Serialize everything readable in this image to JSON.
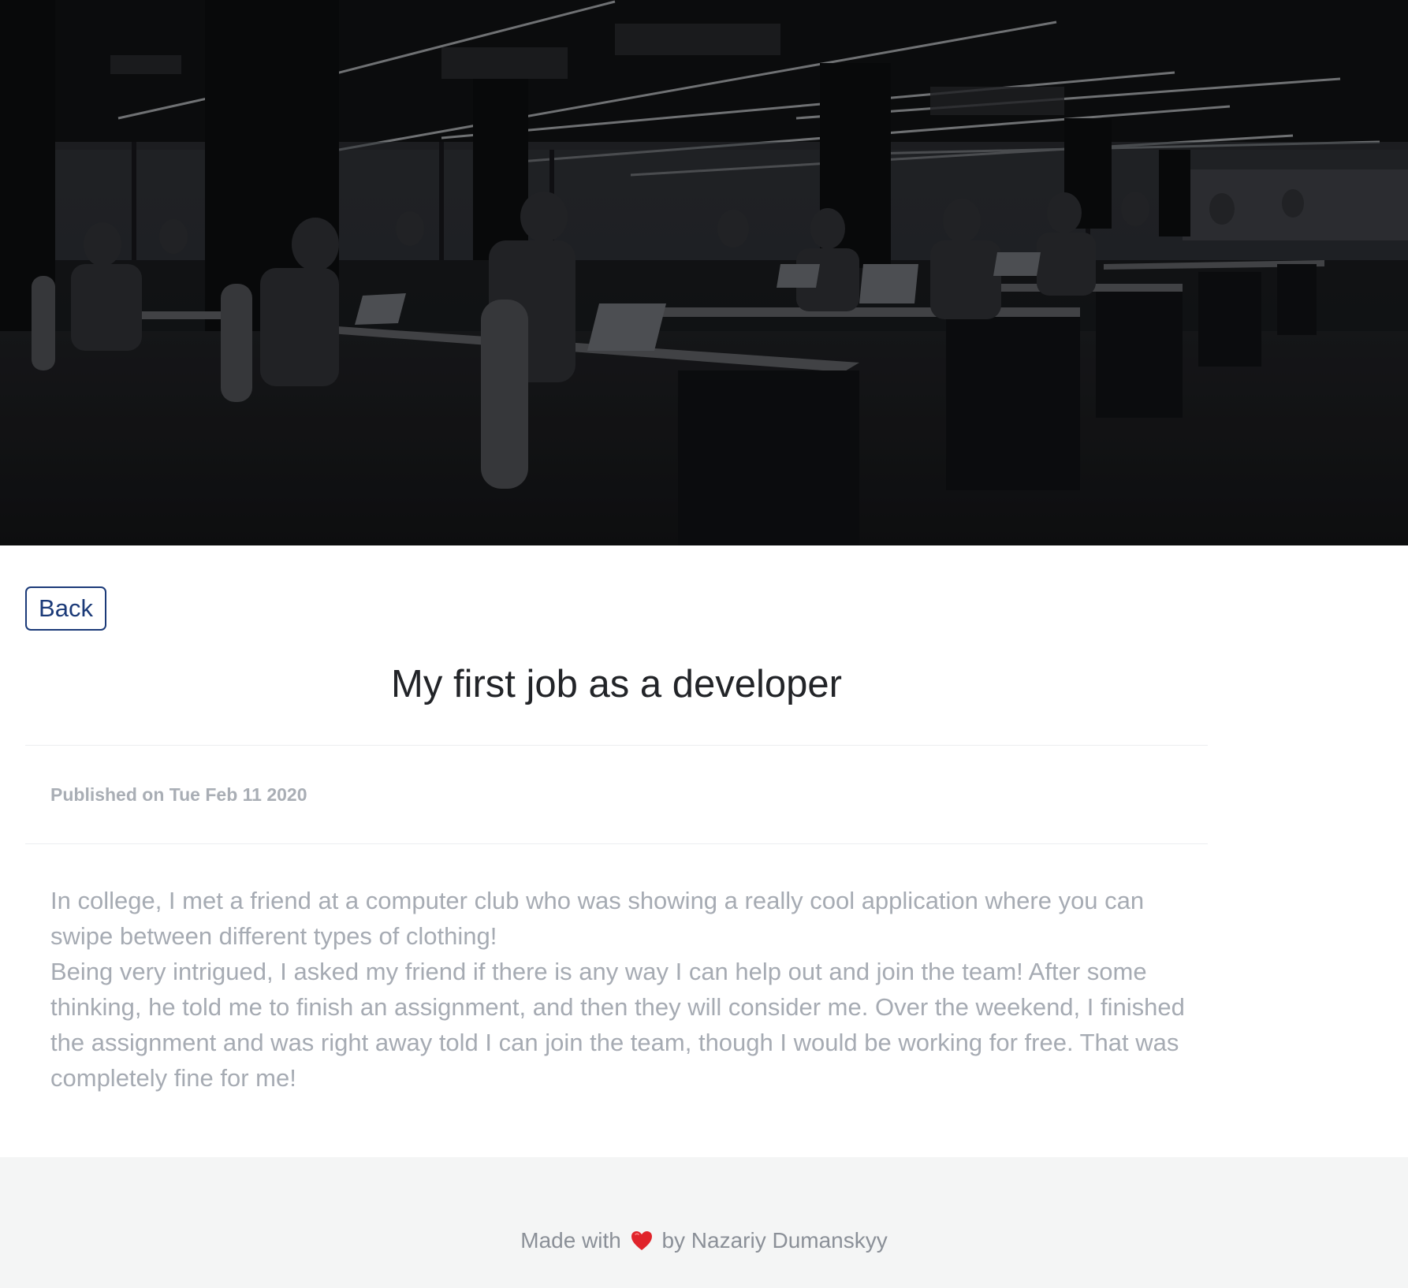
{
  "hero": {
    "image": "dark-open-plan-office-photo"
  },
  "post": {
    "back_label": "Back",
    "title": "My first job as a developer",
    "published": "Published on Tue Feb 11 2020",
    "paragraphs": [
      "In college, I met a friend at a computer club who was showing a really cool application where you can swipe between different types of clothing!",
      "Being very intrigued, I asked my friend if there is any way I can help out and join the team! After some thinking, he told me to finish an assignment, and then they will consider me. Over the weekend, I finished the assignment and was right away told I can join the team, though I would be working for free. That was completely fine for me!"
    ]
  },
  "footer": {
    "made_with": "Made with",
    "icon": "heart-icon",
    "by_author": "by Nazariy Dumanskyy"
  },
  "colors": {
    "accent": "#1b3a78",
    "title": "#222428",
    "muted_text": "#a6abb3",
    "footer_bg": "#f4f5f5",
    "heart": "#e0242b"
  }
}
